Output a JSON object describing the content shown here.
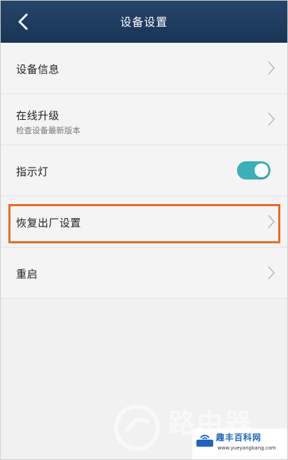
{
  "header": {
    "title": "设备设置"
  },
  "items": [
    {
      "label": "设备信息"
    },
    {
      "label": "在线升级",
      "subtitle": "检查设备最新版本"
    },
    {
      "label": "指示灯",
      "toggle_on": true
    },
    {
      "label": "恢复出厂设置"
    },
    {
      "label": "重启"
    }
  ],
  "colors": {
    "header": "#1f3d62",
    "toggle": "#38b1b8",
    "highlight": "#ec6a1d"
  },
  "watermark": {
    "text": "路由器",
    "site_name": "趣丰百科网",
    "site_url": "www.yueyangbang.com"
  }
}
